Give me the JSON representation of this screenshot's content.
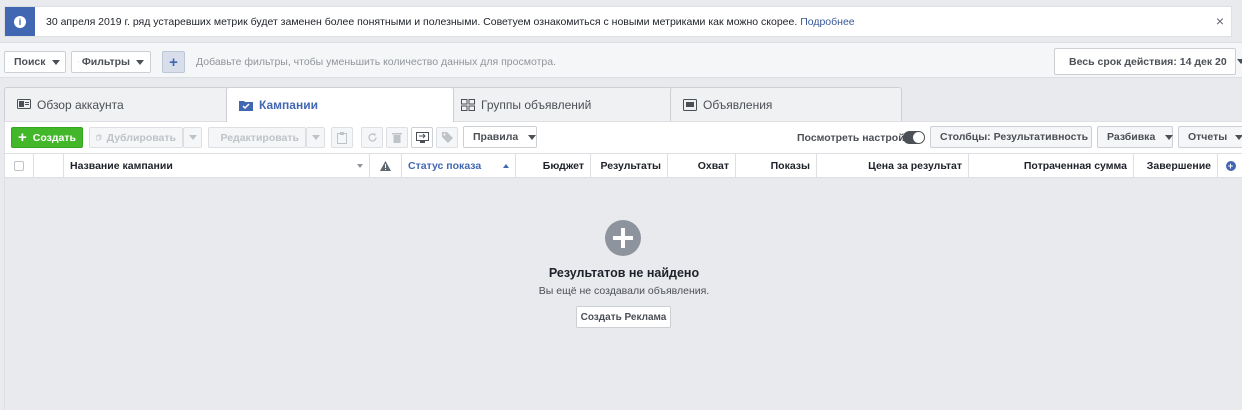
{
  "notice": {
    "text": "30 апреля 2019 г. ряд устаревших метрик будет заменен более понятными и полезными. Советуем ознакомиться с новыми метриками как можно скорее.",
    "link": "Подробнее",
    "close": "×"
  },
  "filters": {
    "search": "Поиск",
    "filters": "Фильтры",
    "add": "+",
    "hint": "Добавьте фильтры, чтобы уменьшить количество данных для просмотра.",
    "date_range": "Весь срок действия: 14 дек 20"
  },
  "tabs": [
    {
      "label": "Обзор аккаунта"
    },
    {
      "label": "Кампании"
    },
    {
      "label": "Группы объявлений"
    },
    {
      "label": "Объявления"
    }
  ],
  "toolbar": {
    "create": "Создать",
    "duplicate": "Дублировать",
    "edit": "Редактировать",
    "rules": "Правила",
    "view_settings": "Посмотреть настройки",
    "columns": "Столбцы: Результативность",
    "breakdown": "Разбивка",
    "reports": "Отчеты"
  },
  "table": {
    "headers": {
      "name": "Название кампании",
      "status": "Статус показа",
      "budget": "Бюджет",
      "results": "Результаты",
      "reach": "Охват",
      "impressions": "Показы",
      "cost_per_result": "Цена за результат",
      "amount_spent": "Потраченная сумма",
      "ends": "Завершение"
    }
  },
  "empty": {
    "title": "Результатов не найдено",
    "subtitle": "Вы ещё не создавали объявления.",
    "button": "Создать Реклама"
  },
  "colors": {
    "brand": "#4267b2",
    "create_green": "#42b72a"
  }
}
